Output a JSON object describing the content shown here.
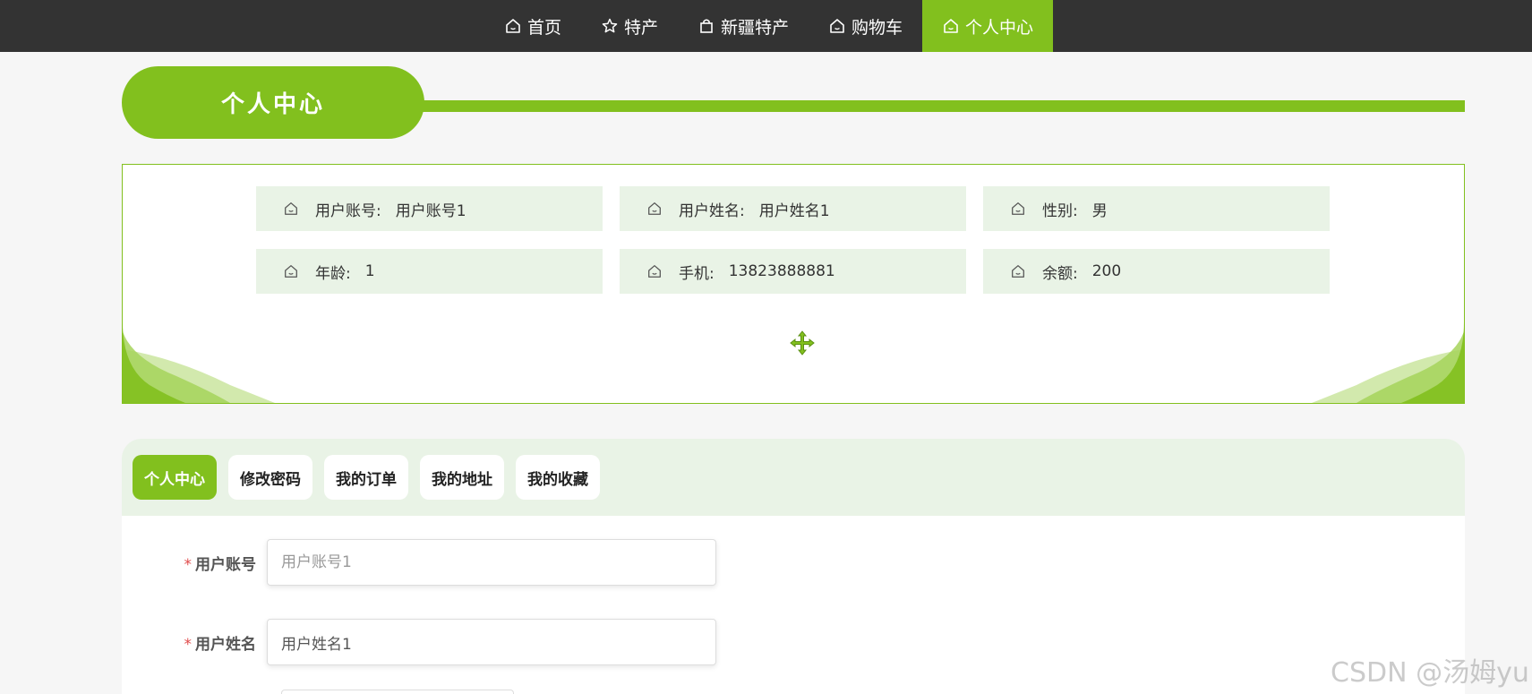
{
  "nav": {
    "items": [
      {
        "label": "首页",
        "icon": "home-icon",
        "active": false
      },
      {
        "label": "特产",
        "icon": "star-icon",
        "active": false
      },
      {
        "label": "新疆特产",
        "icon": "bag-icon",
        "active": false
      },
      {
        "label": "购物车",
        "icon": "home-icon",
        "active": false
      },
      {
        "label": "个人中心",
        "icon": "home-icon",
        "active": true
      }
    ]
  },
  "page_title": "个人中心",
  "profile": {
    "fields": [
      {
        "label": "用户账号:",
        "value": "用户账号1"
      },
      {
        "label": "用户姓名:",
        "value": "用户姓名1"
      },
      {
        "label": "性别:",
        "value": "男"
      },
      {
        "label": "年龄:",
        "value": "1"
      },
      {
        "label": "手机:",
        "value": "13823888881"
      },
      {
        "label": "余额:",
        "value": "200"
      }
    ]
  },
  "tabs": [
    {
      "label": "个人中心",
      "active": true
    },
    {
      "label": "修改密码",
      "active": false
    },
    {
      "label": "我的订单",
      "active": false
    },
    {
      "label": "我的地址",
      "active": false
    },
    {
      "label": "我的收藏",
      "active": false
    }
  ],
  "form": {
    "required_mark": "*",
    "fields": [
      {
        "label": "用户账号",
        "value": "",
        "placeholder": "用户账号1"
      },
      {
        "label": "用户姓名",
        "value": "用户姓名1",
        "placeholder": ""
      }
    ]
  },
  "watermark": "CSDN @汤姆yu",
  "colors": {
    "accent": "#82c01e",
    "nav_bg": "#333333",
    "light_green": "#e9f3e6"
  }
}
